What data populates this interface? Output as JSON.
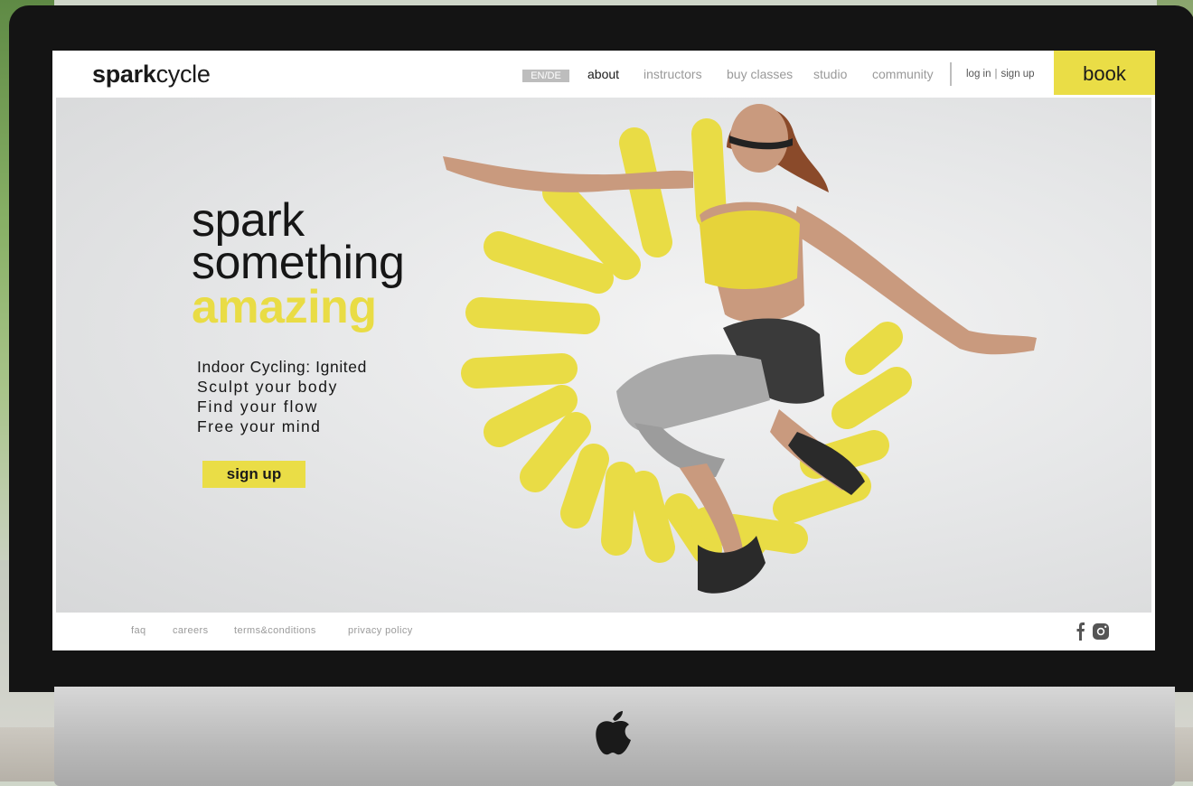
{
  "brand": {
    "bold": "spark",
    "light": "cycle"
  },
  "nav": {
    "lang": "EN/DE",
    "items": [
      "about",
      "instructors",
      "buy classes",
      "studio",
      "community"
    ],
    "login": "log in",
    "separator": "|",
    "signup": "sign up",
    "book": "book"
  },
  "hero": {
    "line1": "spark",
    "line2": "something",
    "line3": "amazing",
    "taglines": [
      "Indoor Cycling: Ignited",
      "Sculpt your body",
      "Find your flow",
      "Free your mind"
    ],
    "cta": "sign up"
  },
  "footer": {
    "links": [
      "faq",
      "careers",
      "terms&conditions",
      "privacy policy"
    ],
    "social": [
      "facebook-icon",
      "instagram-icon"
    ]
  },
  "colors": {
    "accent": "#eadd46",
    "text": "#1a1a1a",
    "muted": "#9a9a9a"
  }
}
